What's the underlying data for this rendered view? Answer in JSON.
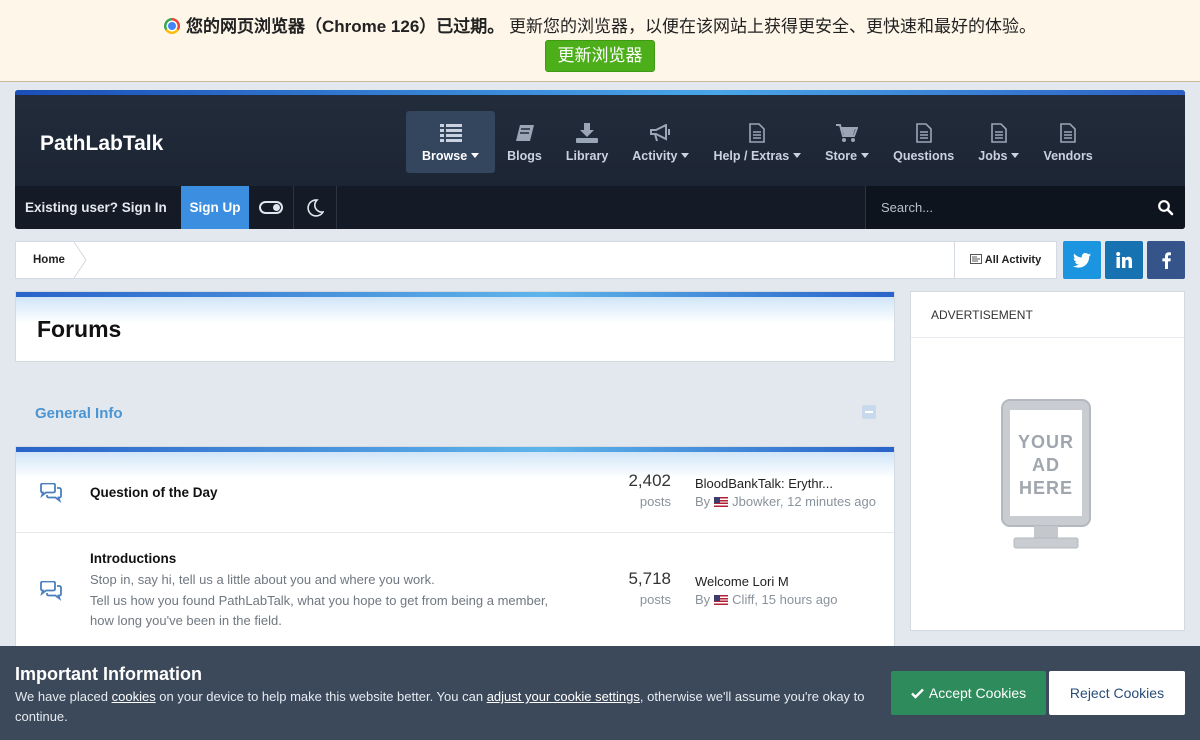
{
  "browser_banner": {
    "bold_text": "您的网页浏览器（Chrome 126）已过期。",
    "message": "更新您的浏览器，以便在该网站上获得更安全、更快速和最好的体验。",
    "update_label": "更新浏览器"
  },
  "header": {
    "site_title": "PathLabTalk",
    "nav": [
      {
        "label": "Browse",
        "icon": "list-icon",
        "dropdown": true,
        "active": true
      },
      {
        "label": "Blogs",
        "icon": "book-icon",
        "dropdown": false
      },
      {
        "label": "Library",
        "icon": "download-icon",
        "dropdown": false
      },
      {
        "label": "Activity",
        "icon": "megaphone-icon",
        "dropdown": true
      },
      {
        "label": "Help / Extras",
        "icon": "document-icon",
        "dropdown": true
      },
      {
        "label": "Store",
        "icon": "cart-icon",
        "dropdown": true
      },
      {
        "label": "Questions",
        "icon": "document-icon",
        "dropdown": false
      },
      {
        "label": "Jobs",
        "icon": "document-icon",
        "dropdown": true
      },
      {
        "label": "Vendors",
        "icon": "document-icon",
        "dropdown": false
      }
    ]
  },
  "user_bar": {
    "sign_in": "Existing user? Sign In",
    "sign_up": "Sign Up",
    "search_placeholder": "Search..."
  },
  "breadcrumb": {
    "home": "Home",
    "all_activity": "All Activity"
  },
  "page": {
    "title": "Forums",
    "category": "General Info"
  },
  "forums": [
    {
      "name": "Question of the Day",
      "description": [],
      "posts": "2,402",
      "posts_label": "posts",
      "last_title": "BloodBankTalk: Erythr...",
      "last_by": "By",
      "last_author": "Jbowker",
      "last_time": ", 12 minutes ago"
    },
    {
      "name": "Introductions",
      "description": [
        "Stop in, say hi, tell us a little about you and where you work.",
        "Tell us how you found PathLabTalk, what you hope to get from being a member,",
        "how long you've been in the field."
      ],
      "posts": "5,718",
      "posts_label": "posts",
      "last_title": "Welcome Lori M",
      "last_by": "By",
      "last_author": "Cliff",
      "last_time": ", 15 hours ago"
    }
  ],
  "advertisement": {
    "header": "ADVERTISEMENT",
    "ad_lines": [
      "YOUR",
      "AD",
      "HERE"
    ]
  },
  "cookie_notice": {
    "title": "Important Information",
    "text_1": "We have placed ",
    "link_cookies": "cookies",
    "text_2": " on your device to help make this website better. You can ",
    "link_settings": "adjust your cookie settings",
    "text_3": ", otherwise we'll assume you're okay to continue.",
    "accept": "Accept Cookies",
    "reject": "Reject Cookies"
  },
  "colors": {
    "accent_blue": "#3b8ee0",
    "header_bg": "#1a2230",
    "accept_green": "#2e8b5b",
    "update_green": "#4caf1a"
  }
}
